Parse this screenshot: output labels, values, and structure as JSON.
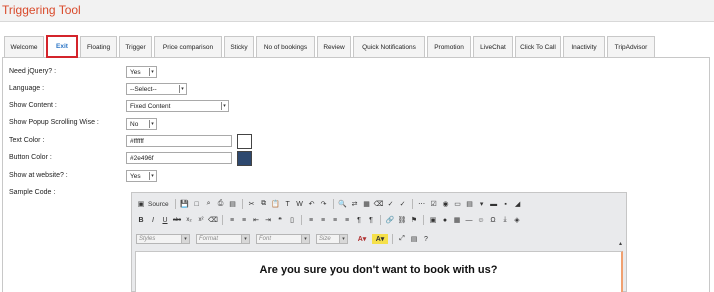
{
  "page": {
    "title": "Triggering Tool"
  },
  "tabs": [
    {
      "label": "Welcome"
    },
    {
      "label": "Exit",
      "active": true
    },
    {
      "label": "Floating"
    },
    {
      "label": "Trigger"
    },
    {
      "label": "Price comparison"
    },
    {
      "label": "Sticky"
    },
    {
      "label": "No of bookings"
    },
    {
      "label": "Review"
    },
    {
      "label": "Quick Notifications"
    },
    {
      "label": "Promotion"
    },
    {
      "label": "LiveChat"
    },
    {
      "label": "Click To Call"
    },
    {
      "label": "Inactivity"
    },
    {
      "label": "TripAdvisor"
    }
  ],
  "form": {
    "need_jquery": {
      "label": "Need jQuery? :",
      "value": "Yes"
    },
    "language": {
      "label": "Language :",
      "value": "--Select--"
    },
    "show_content": {
      "label": "Show Content :",
      "value": "Fixed Content"
    },
    "show_popup_scrolling": {
      "label": "Show Popup Scrolling Wise :",
      "value": "No"
    },
    "text_color": {
      "label": "Text Color :",
      "value": "#ffffff",
      "swatch": "#ffffff"
    },
    "button_color": {
      "label": "Button Color :",
      "value": "#2e496f",
      "swatch": "#2e496f"
    },
    "show_at_website": {
      "label": "Show at website? :",
      "value": "Yes"
    },
    "sample_code": {
      "label": "Sample Code :"
    }
  },
  "editor": {
    "source_label": "Source",
    "styles_placeholder": "Styles",
    "format_placeholder": "Format",
    "font_placeholder": "Font",
    "size_placeholder": "Size",
    "content_heading": "Are you sure you don't want to book with us?"
  },
  "colors": {
    "accent_title": "#d94a2b",
    "active_tab_border": "#d4242b"
  }
}
